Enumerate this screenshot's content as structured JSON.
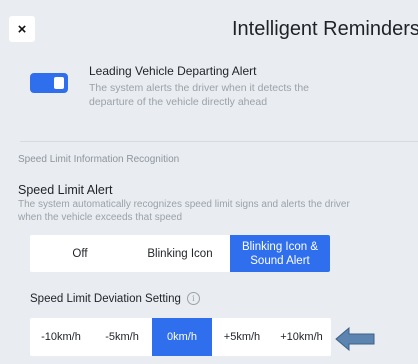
{
  "header": {
    "close_label": "×",
    "title": "Intelligent Reminders"
  },
  "leading_vehicle": {
    "enabled": true,
    "title": "Leading Vehicle Departing Alert",
    "description": "The system alerts the driver when it detects the departure of the vehicle directly ahead"
  },
  "speed_limit_section": {
    "label": "Speed Limit Information Recognition",
    "alert_title": "Speed Limit Alert",
    "alert_description": "The system automatically recognizes speed limit signs and alerts the driver when the vehicle exceeds that speed",
    "alert_options": [
      "Off",
      "Blinking Icon",
      "Blinking Icon & Sound Alert"
    ],
    "alert_selected": "Blinking Icon & Sound Alert",
    "deviation_label": "Speed Limit Deviation Setting",
    "deviation_options": [
      "-10km/h",
      "-5km/h",
      "0km/h",
      "+5km/h",
      "+10km/h"
    ],
    "deviation_selected": "0km/h"
  },
  "colors": {
    "accent": "#2f6fed",
    "background": "#e9edf1",
    "arrow": "#5b84b1"
  },
  "icons": {
    "close": "close-icon",
    "info": "info-icon",
    "pointer": "left-arrow-icon"
  }
}
